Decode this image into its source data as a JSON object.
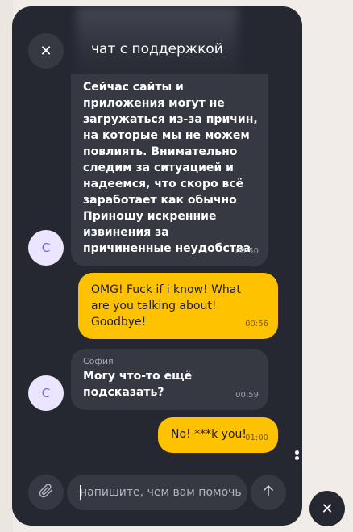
{
  "chat": {
    "title": "чат с поддержкой",
    "close_glyph": "✕",
    "messages": [
      {
        "direction": "incoming",
        "text": "Сейчас сайты и\nприложения могут не\nзагружаться из-за причин,\nна которые мы не можем\nповлиять. Внимательно\nследим за ситуацией и\nнадеемся, что скоро всё\nзаработает как обычно\nПриношу искренние\nизвинения за\nпричиненные неудобства",
        "time": "00:50",
        "avatar": "С"
      },
      {
        "direction": "outgoing",
        "text": "OMG! Fuck if i know! What\nare you talking about!\nGoodbye!",
        "time": "00:56"
      },
      {
        "direction": "incoming",
        "sender": "София",
        "text": "Могу что-то ещё\nподсказать?",
        "time": "00:59",
        "avatar": "С"
      },
      {
        "direction": "outgoing",
        "text": "No! ***k you!",
        "time": "01:00"
      }
    ]
  },
  "composer": {
    "placeholder": "напишите, чем вам помочь",
    "value": "",
    "attach_icon": "paperclip-icon",
    "send_icon": "arrow-up-icon"
  },
  "widget": {
    "close_glyph": "✕"
  },
  "colors": {
    "panel_bg": "#252830",
    "bubble_incoming": "#363942",
    "bubble_outgoing": "#ffc200",
    "avatar_bg": "#ece5ff",
    "avatar_text": "#7b5cf0"
  }
}
